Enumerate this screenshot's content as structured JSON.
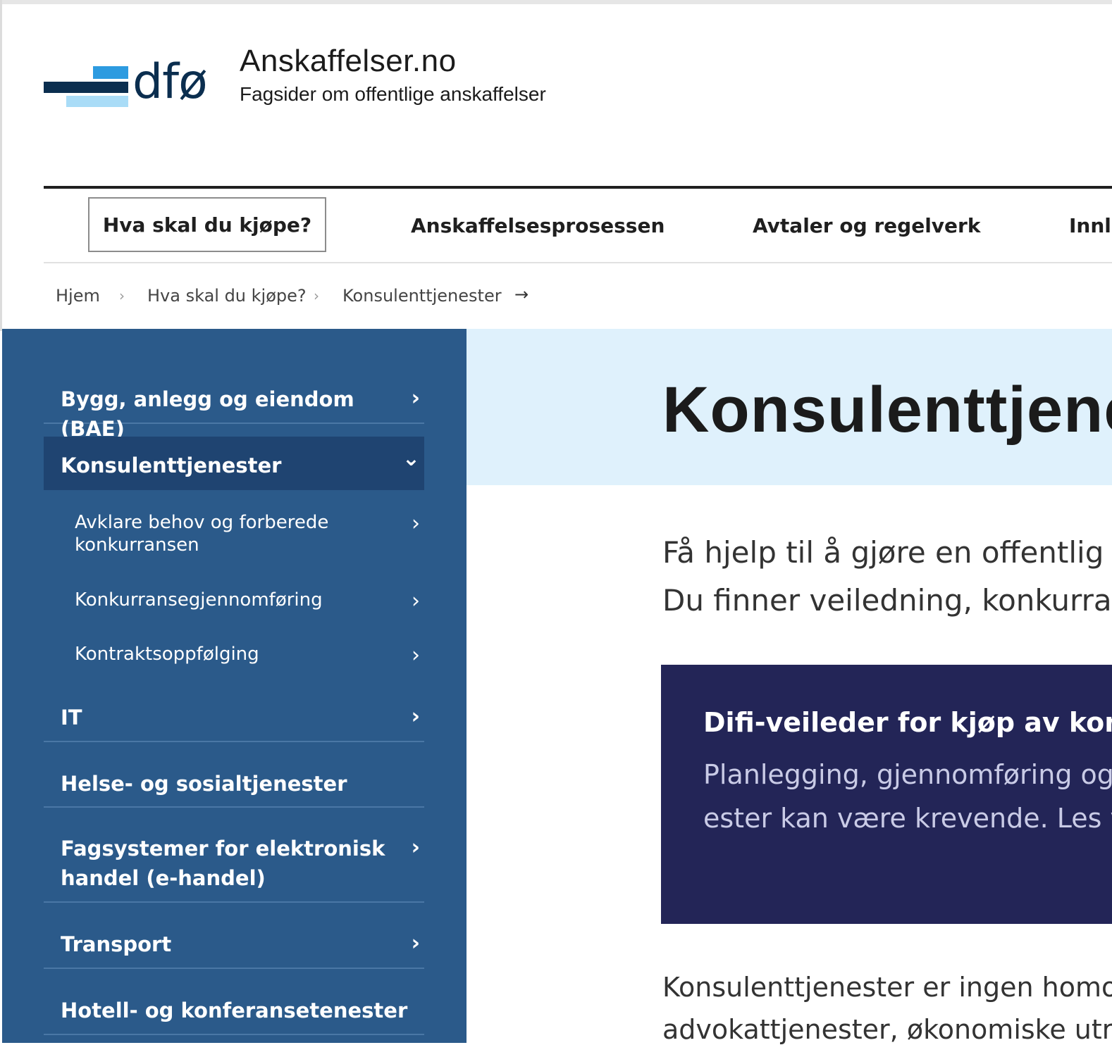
{
  "header": {
    "logo_text": "dfø",
    "site_title": "Anskaffelser.no",
    "site_subtitle": "Fagsider om offentlige anskaffelser"
  },
  "nav": {
    "items": [
      {
        "label": "Hva skal du kjøpe?"
      },
      {
        "label": "Anskaffelsesprosessen"
      },
      {
        "label": "Avtaler og regelverk"
      },
      {
        "label": "Innl"
      }
    ]
  },
  "breadcrumb": {
    "items": [
      "Hjem",
      "Hva skal du kjøpe?",
      "Konsulenttjenester"
    ],
    "separator": "›",
    "arrow": "→"
  },
  "sidebar": {
    "items": [
      {
        "label": "Bygg, anlegg og eiendom (BAE)",
        "chevron": "›"
      },
      {
        "label": "Konsulenttjenester",
        "chevron": "⌄"
      },
      {
        "label": "IT",
        "chevron": "›"
      },
      {
        "label": "Helse- og sosialtjenester"
      },
      {
        "label_line1": "Fagsystemer for elektronisk",
        "label_line2": "handel (e-handel)",
        "chevron": "›"
      },
      {
        "label": "Transport",
        "chevron": "›"
      },
      {
        "label": "Hotell- og konferansetenester"
      }
    ],
    "subitems": [
      {
        "label_line1": "Avklare behov og forberede",
        "label_line2": "konkurransen",
        "chevron": "›"
      },
      {
        "label": "Konkurransegjennomføring",
        "chevron": "›"
      },
      {
        "label": "Kontraktsoppfølging",
        "chevron": "›"
      }
    ]
  },
  "main": {
    "title": "Konsulenttjene",
    "lead_line1": "Få hjelp til å gjøre en offentlig",
    "lead_line2": "Du finner veiledning, konkurra",
    "card": {
      "title": "Difi-veileder for kjøp av kons",
      "text_line1": "Planlegging, gjennomføring og",
      "text_line2": "ester kan være krevende. Les v"
    },
    "body_line1": "Konsulenttjenester er ingen homo",
    "body_line2": "advokattjenester, økonomiske utr"
  },
  "colors": {
    "sidebar_bg": "#2b5a8a",
    "sidebar_open_bg": "#1f4471",
    "hero_bg": "#dff1fc",
    "card_bg": "#232557"
  }
}
